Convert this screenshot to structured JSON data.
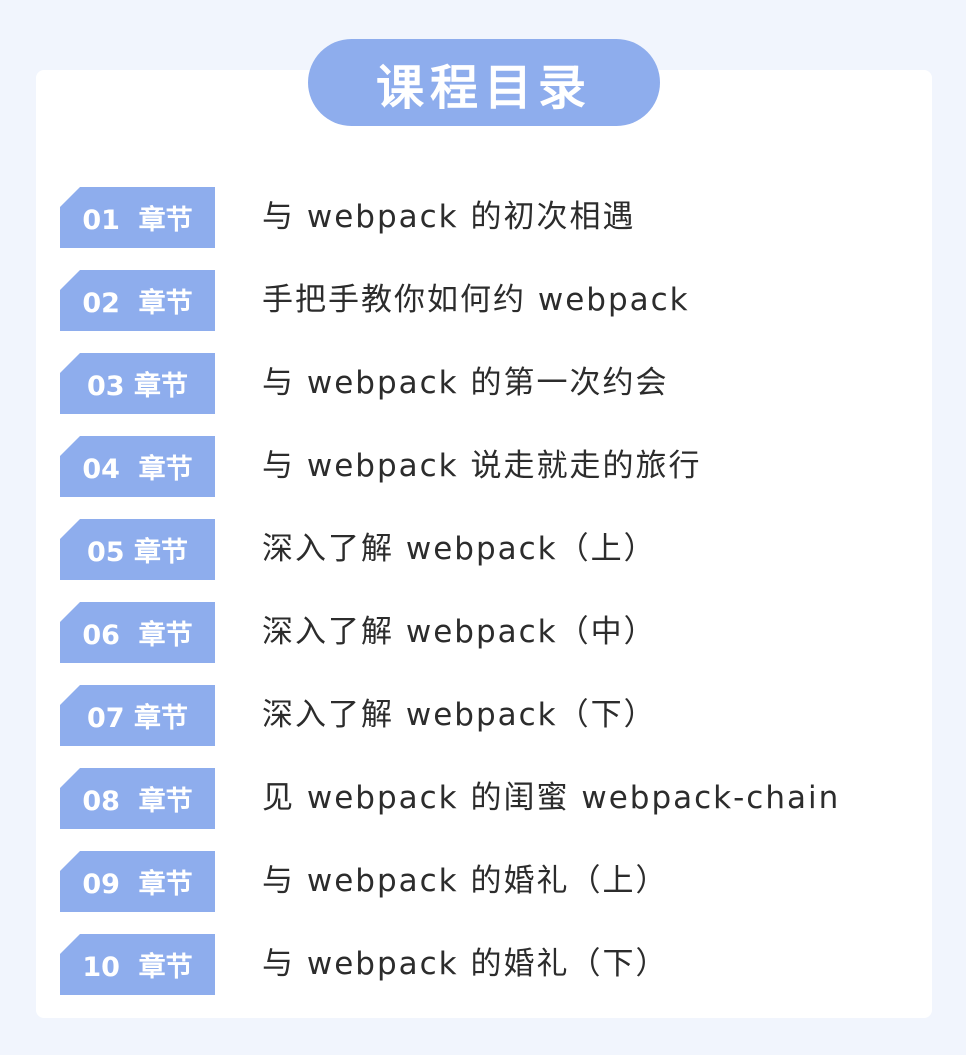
{
  "page_title": "课程目录",
  "colors": {
    "page_background": "#f1f5fd",
    "card_background": "#ffffff",
    "accent": "#8eaded",
    "badge_text": "#ffffff",
    "item_text": "#2c2c2c"
  },
  "chapters": [
    {
      "badge": "01  章节",
      "title": "与 webpack 的初次相遇"
    },
    {
      "badge": "02  章节",
      "title": "手把手教你如何约 webpack"
    },
    {
      "badge": "03 章节",
      "title": "与 webpack 的第一次约会"
    },
    {
      "badge": "04  章节",
      "title": "与 webpack 说走就走的旅行"
    },
    {
      "badge": "05 章节",
      "title": "深入了解 webpack（上）"
    },
    {
      "badge": "06  章节",
      "title": "深入了解 webpack（中）"
    },
    {
      "badge": "07 章节",
      "title": "深入了解 webpack（下）"
    },
    {
      "badge": "08  章节",
      "title": "见 webpack 的闺蜜 webpack-chain"
    },
    {
      "badge": "09  章节",
      "title": "与 webpack 的婚礼（上）"
    },
    {
      "badge": "10  章节",
      "title": "与 webpack 的婚礼（下）"
    }
  ]
}
